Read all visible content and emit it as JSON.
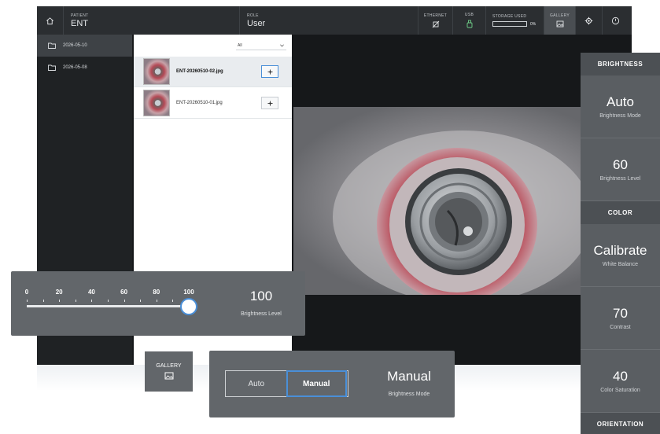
{
  "topbar": {
    "patient_caption": "PATIENT",
    "patient_value": "ENT",
    "role_caption": "ROLE",
    "role_value": "User",
    "ethernet_caption": "ETHERNET",
    "usb_caption": "USB",
    "storage_caption": "STORAGE USED",
    "storage_percent": "0%",
    "storage_used_fraction": 0,
    "gallery_caption": "GALLERY"
  },
  "folders": [
    {
      "label": "2026-05-10",
      "selected": true
    },
    {
      "label": "2026-05-08",
      "selected": false
    }
  ],
  "filter": {
    "value": "All"
  },
  "files": [
    {
      "name": "ENT-20260510-02.jpg",
      "selected": true
    },
    {
      "name": "ENT-20260510-01.jpg",
      "selected": false
    }
  ],
  "right_panel": {
    "brightness_header": "BRIGHTNESS",
    "brightness_mode_value": "Auto",
    "brightness_mode_label": "Brightness Mode",
    "brightness_level_value": "60",
    "brightness_level_label": "Brightness Level",
    "color_header": "COLOR",
    "white_balance_value": "Calibrate",
    "white_balance_label": "White Balance",
    "contrast_value": "70",
    "contrast_label": "Contrast",
    "saturation_value": "40",
    "saturation_label": "Color Saturation",
    "orientation_header": "ORIENTATION"
  },
  "brightness_slider": {
    "ticks": [
      "0",
      "20",
      "40",
      "60",
      "80",
      "100"
    ],
    "value": 100,
    "value_label": "100",
    "caption": "Brightness Level"
  },
  "gallery_button": {
    "label": "GALLERY"
  },
  "mode_selector": {
    "auto_label": "Auto",
    "manual_label": "Manual",
    "selected": "Manual",
    "value": "Manual",
    "caption": "Brightness Mode"
  },
  "colors": {
    "accent": "#4a8fd8",
    "overlay": "#62666a",
    "topbar": "#2b2e31"
  }
}
